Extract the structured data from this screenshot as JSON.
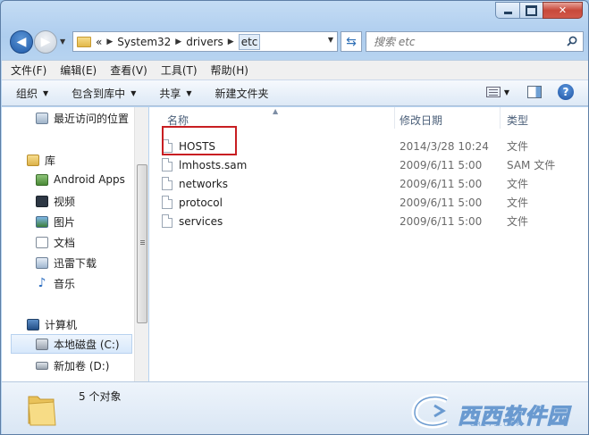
{
  "addressbar": {
    "overflow": "«",
    "crumbs": [
      "System32",
      "drivers",
      "etc"
    ],
    "search_placeholder": "搜索 etc"
  },
  "menubar": {
    "items": [
      "文件(F)",
      "编辑(E)",
      "查看(V)",
      "工具(T)",
      "帮助(H)"
    ]
  },
  "toolbar": {
    "organize": "组织",
    "include_library": "包含到库中",
    "share": "共享",
    "new_folder": "新建文件夹",
    "help": "?"
  },
  "nav": {
    "recent": "最近访问的位置",
    "libraries": "库",
    "library_items": [
      "Android Apps",
      "视频",
      "图片",
      "文档",
      "迅雷下载",
      "音乐"
    ],
    "computer": "计算机",
    "drives": [
      "本地磁盘 (C:)",
      "新加卷 (D:)"
    ]
  },
  "columns": {
    "name": "名称",
    "date": "修改日期",
    "type": "类型"
  },
  "files": [
    {
      "name": "HOSTS",
      "date": "2014/3/28 10:24",
      "type": "文件"
    },
    {
      "name": "lmhosts.sam",
      "date": "2009/6/11 5:00",
      "type": "SAM 文件"
    },
    {
      "name": "networks",
      "date": "2009/6/11 5:00",
      "type": "文件"
    },
    {
      "name": "protocol",
      "date": "2009/6/11 5:00",
      "type": "文件"
    },
    {
      "name": "services",
      "date": "2009/6/11 5:00",
      "type": "文件"
    }
  ],
  "status": {
    "count": "5 个对象"
  },
  "watermark": {
    "text": "西西软件园",
    "sub": "CR173.COM"
  },
  "colors": {
    "highlight_border": "#c81e22",
    "accent": "#2f6fb6"
  }
}
